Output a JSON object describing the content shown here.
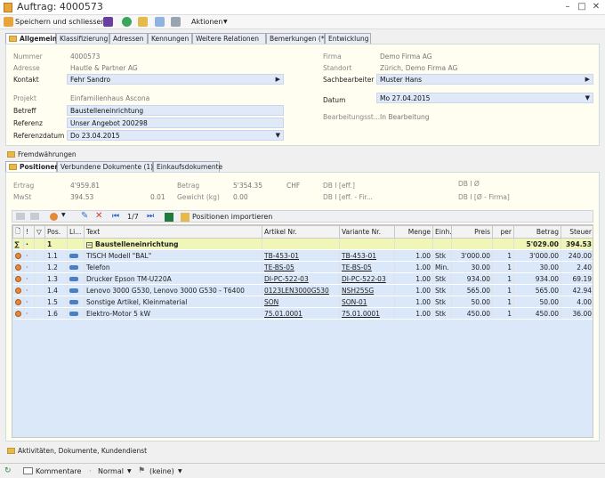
{
  "window": {
    "title": "Auftrag: 4000573"
  },
  "toolbar": {
    "save_close": "Speichern und schliessen",
    "actions": "Aktionen"
  },
  "main_tabs": [
    "Allgemein",
    "Klassifizierung",
    "Adressen",
    "Kennungen",
    "Weitere Relationen",
    "Bemerkungen (*)",
    "Entwicklung"
  ],
  "general": {
    "nummer_label": "Nummer",
    "nummer": "4000573",
    "adresse_label": "Adresse",
    "adresse": "Hautle & Partner AG",
    "kontakt_label": "Kontakt",
    "kontakt": "Fehr Sandro",
    "projekt_label": "Projekt",
    "projekt": "Einfamilienhaus Ascona",
    "betreff_label": "Betreff",
    "betreff": "Baustelleneinrichtung",
    "referenz_label": "Referenz",
    "referenz": "Unser Angebot 200298",
    "referenzdatum_label": "Referenzdatum",
    "referenzdatum": "Do 23.04.2015",
    "firma_label": "Firma",
    "firma": "Demo Firma AG",
    "standort_label": "Standort",
    "standort": "Zürich, Demo Firma AG",
    "sachbearbeiter_label": "Sachbearbeiter",
    "sachbearbeiter": "Muster Hans",
    "datum_label": "Datum",
    "datum": "Mo 27.04.2015",
    "status_label": "Bearbeitungsst...",
    "status": "In Bearbeitung"
  },
  "fremdwaehrungen": "Fremdwährungen",
  "sub_tabs": [
    "Positionen",
    "Verbundene Dokumente (1)",
    "Einkaufsdokumente"
  ],
  "summary": {
    "ertrag_label": "Ertrag",
    "ertrag": "4'959.81",
    "betrag_label": "Betrag",
    "betrag": "5'354.35",
    "currency": "CHF",
    "db1_label": "DB I [eff.]",
    "db1b_label": "DB I Ø",
    "mwst_label": "MwSt",
    "mwst": "394.53",
    "mwst2": "0.01",
    "gewicht_label": "Gewicht (kg)",
    "gewicht": "0.00",
    "db2_label": "DB I [eff. - Fir...",
    "db2b_label": "DB I [Ø - Firma]"
  },
  "grid_toolbar": {
    "page": "1/7",
    "import": "Positionen importieren"
  },
  "columns": [
    "",
    "!",
    "",
    "Pos.",
    "Li...",
    "Text",
    "Artikel Nr.",
    "Variante Nr.",
    "Menge",
    "Einh.",
    "Preis",
    "per",
    "Betrag",
    "Steuer"
  ],
  "group_row": {
    "sigma": "∑",
    "pos": "1",
    "text": "Baustelleneinrichtung",
    "betrag": "5'029.00",
    "steuer": "394.53"
  },
  "rows": [
    {
      "pos": "1.1",
      "text": "TISCH Modell \"BAL\"",
      "artikel": "TB-453-01",
      "variante": "TB-453-01",
      "menge": "1.00",
      "einh": "Stk",
      "preis": "3'000.00",
      "per": "1",
      "betrag": "3'000.00",
      "steuer": "240.00"
    },
    {
      "pos": "1.2",
      "text": "Telefon",
      "artikel": "TE-BS-05",
      "variante": "TE-BS-05",
      "menge": "1.00",
      "einh": "Min.",
      "preis": "30.00",
      "per": "1",
      "betrag": "30.00",
      "steuer": "2.40"
    },
    {
      "pos": "1.3",
      "text": "Drucker Epson TM-U220A",
      "artikel": "DI-PC-522-03",
      "variante": "DI-PC-522-03",
      "menge": "1.00",
      "einh": "Stk",
      "preis": "934.00",
      "per": "1",
      "betrag": "934.00",
      "steuer": "69.19"
    },
    {
      "pos": "1.4",
      "text": "Lenovo 3000 G530, Lenovo 3000 G530 - T6400",
      "artikel": "0123LEN3000G530",
      "variante": "NSH25SG",
      "menge": "1.00",
      "einh": "Stk",
      "preis": "565.00",
      "per": "1",
      "betrag": "565.00",
      "steuer": "42.94"
    },
    {
      "pos": "1.5",
      "text": "Sonstige Artikel, Kleinmaterial",
      "artikel": "SON",
      "variante": "SON-01",
      "menge": "1.00",
      "einh": "Stk",
      "preis": "50.00",
      "per": "1",
      "betrag": "50.00",
      "steuer": "4.00"
    },
    {
      "pos": "1.6",
      "text": "Elektro-Motor 5 kW",
      "artikel": "75.01.0001",
      "variante": "75.01.0001",
      "menge": "1.00",
      "einh": "Stk",
      "preis": "450.00",
      "per": "1",
      "betrag": "450.00",
      "steuer": "36.00"
    }
  ],
  "bottom_section": "Aktivitäten, Dokumente, Kundendienst",
  "statusbar": {
    "kommentare": "Kommentare",
    "priority": "Normal",
    "flag": "(keine)"
  }
}
